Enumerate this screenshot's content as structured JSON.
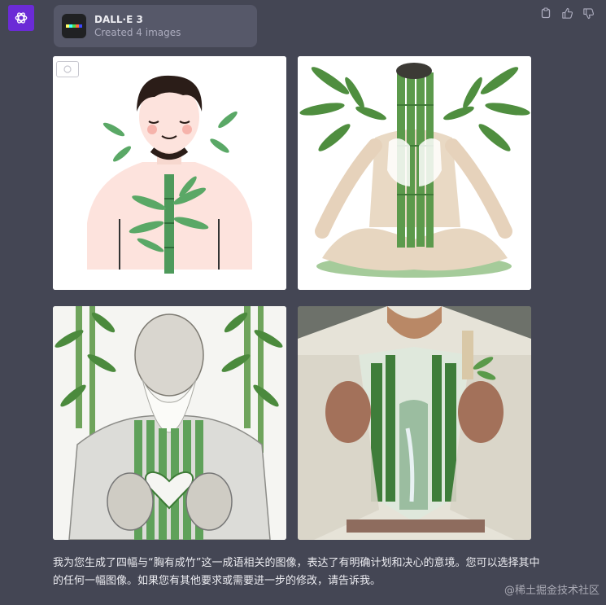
{
  "assistant": {
    "avatar_icon": "openai-logo-icon",
    "avatar_color": "#6b2bd6"
  },
  "plugin": {
    "name": "DALL·E 3",
    "status": "Created 4 images"
  },
  "actions": {
    "items": [
      "copy-icon",
      "thumbs-up-icon",
      "thumbs-down-icon"
    ]
  },
  "images": [
    {
      "id": 1,
      "subject": "illustrated man with bamboo on chest"
    },
    {
      "id": 2,
      "subject": "meditating figure with bamboo body"
    },
    {
      "id": 3,
      "subject": "elderly sage holding bamboo heart"
    },
    {
      "id": 4,
      "subject": "man opening robe revealing bamboo forest"
    }
  ],
  "message": {
    "text": "我为您生成了四幅与“胸有成竹”这一成语相关的图像，表达了有明确计划和决心的意境。您可以选择其中的任何一幅图像。如果您有其他要求或需要进一步的修改，请告诉我。"
  },
  "watermark": {
    "text": "@稀土掘金技术社区"
  }
}
